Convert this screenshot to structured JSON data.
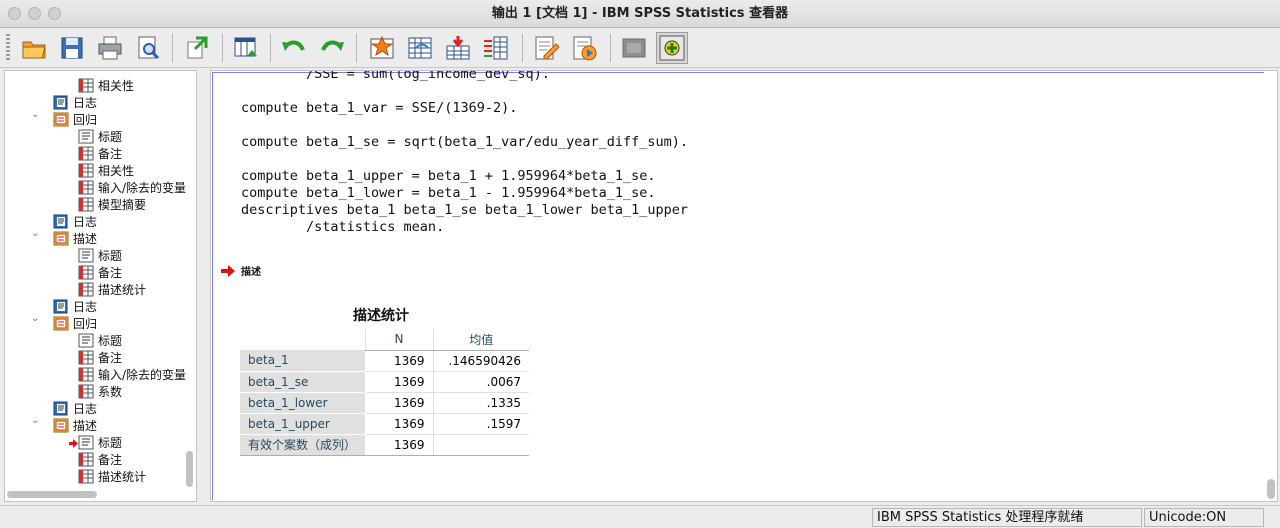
{
  "window": {
    "title": "输出 1 [文档 1] - IBM SPSS Statistics 查看器"
  },
  "toolbar": {
    "icons": [
      "open-folder",
      "save-disk",
      "print",
      "print-preview",
      "export",
      "goto-data",
      "undo",
      "redo",
      "goto-case",
      "goto-variable",
      "insert-cases",
      "insert-variables",
      "designate-window",
      "run-script",
      "hide-output",
      "promote"
    ]
  },
  "outline": {
    "items": [
      {
        "label": "相关性",
        "icon": "table-icon",
        "level": 2
      },
      {
        "label": "日志",
        "icon": "log-book-icon",
        "level": 1
      },
      {
        "label": "回归",
        "icon": "procedure-icon",
        "level": 1,
        "expanded": true
      },
      {
        "label": "标题",
        "icon": "title-icon",
        "level": 2
      },
      {
        "label": "备注",
        "icon": "notes-icon",
        "level": 2
      },
      {
        "label": "相关性",
        "icon": "table-icon",
        "level": 2
      },
      {
        "label": "输入/除去的变量",
        "icon": "table-icon",
        "level": 2
      },
      {
        "label": "模型摘要",
        "icon": "table-icon",
        "level": 2
      },
      {
        "label": "日志",
        "icon": "log-book-icon",
        "level": 1
      },
      {
        "label": "描述",
        "icon": "procedure-icon",
        "level": 1,
        "expanded": true
      },
      {
        "label": "标题",
        "icon": "title-icon",
        "level": 2
      },
      {
        "label": "备注",
        "icon": "notes-icon",
        "level": 2
      },
      {
        "label": "描述统计",
        "icon": "table-icon",
        "level": 2
      },
      {
        "label": "日志",
        "icon": "log-book-icon",
        "level": 1
      },
      {
        "label": "回归",
        "icon": "procedure-icon",
        "level": 1,
        "expanded": true
      },
      {
        "label": "标题",
        "icon": "title-icon",
        "level": 2
      },
      {
        "label": "备注",
        "icon": "notes-icon",
        "level": 2
      },
      {
        "label": "输入/除去的变量",
        "icon": "table-icon",
        "level": 2
      },
      {
        "label": "系数",
        "icon": "table-icon",
        "level": 2
      },
      {
        "label": "日志",
        "icon": "log-book-icon",
        "level": 1
      },
      {
        "label": "描述",
        "icon": "procedure-icon",
        "level": 1,
        "expanded": true
      },
      {
        "label": "标题",
        "icon": "title-icon",
        "level": 2,
        "current": true
      },
      {
        "label": "备注",
        "icon": "notes-icon",
        "level": 2
      },
      {
        "label": "描述统计",
        "icon": "table-icon",
        "level": 2
      }
    ]
  },
  "viewer": {
    "syntax_lines": [
      "        /SSE = sum(log_income_dev_sq).",
      "",
      "compute beta_1_var = SSE/(1369-2).",
      "",
      "compute beta_1_se = sqrt(beta_1_var/edu_year_diff_sum).",
      "",
      "compute beta_1_upper = beta_1 + 1.959964*beta_1_se.",
      "compute beta_1_lower = beta_1 - 1.959964*beta_1_se.",
      "descriptives beta_1 beta_1_se beta_1_lower beta_1_upper",
      "        /statistics mean."
    ],
    "section_heading": "描述",
    "table": {
      "title": "描述统计",
      "col_n": "N",
      "col_mean": "均值",
      "rows": [
        {
          "name": "beta_1",
          "n": "1369",
          "mean": ".146590426"
        },
        {
          "name": "beta_1_se",
          "n": "1369",
          "mean": ".0067"
        },
        {
          "name": "beta_1_lower",
          "n": "1369",
          "mean": ".1335"
        },
        {
          "name": "beta_1_upper",
          "n": "1369",
          "mean": ".1597"
        },
        {
          "name": "有效个案数（成列）",
          "n": "1369",
          "mean": ""
        }
      ]
    }
  },
  "status": {
    "processor": "IBM SPSS Statistics 处理程序就绪",
    "unicode": "Unicode:ON"
  }
}
